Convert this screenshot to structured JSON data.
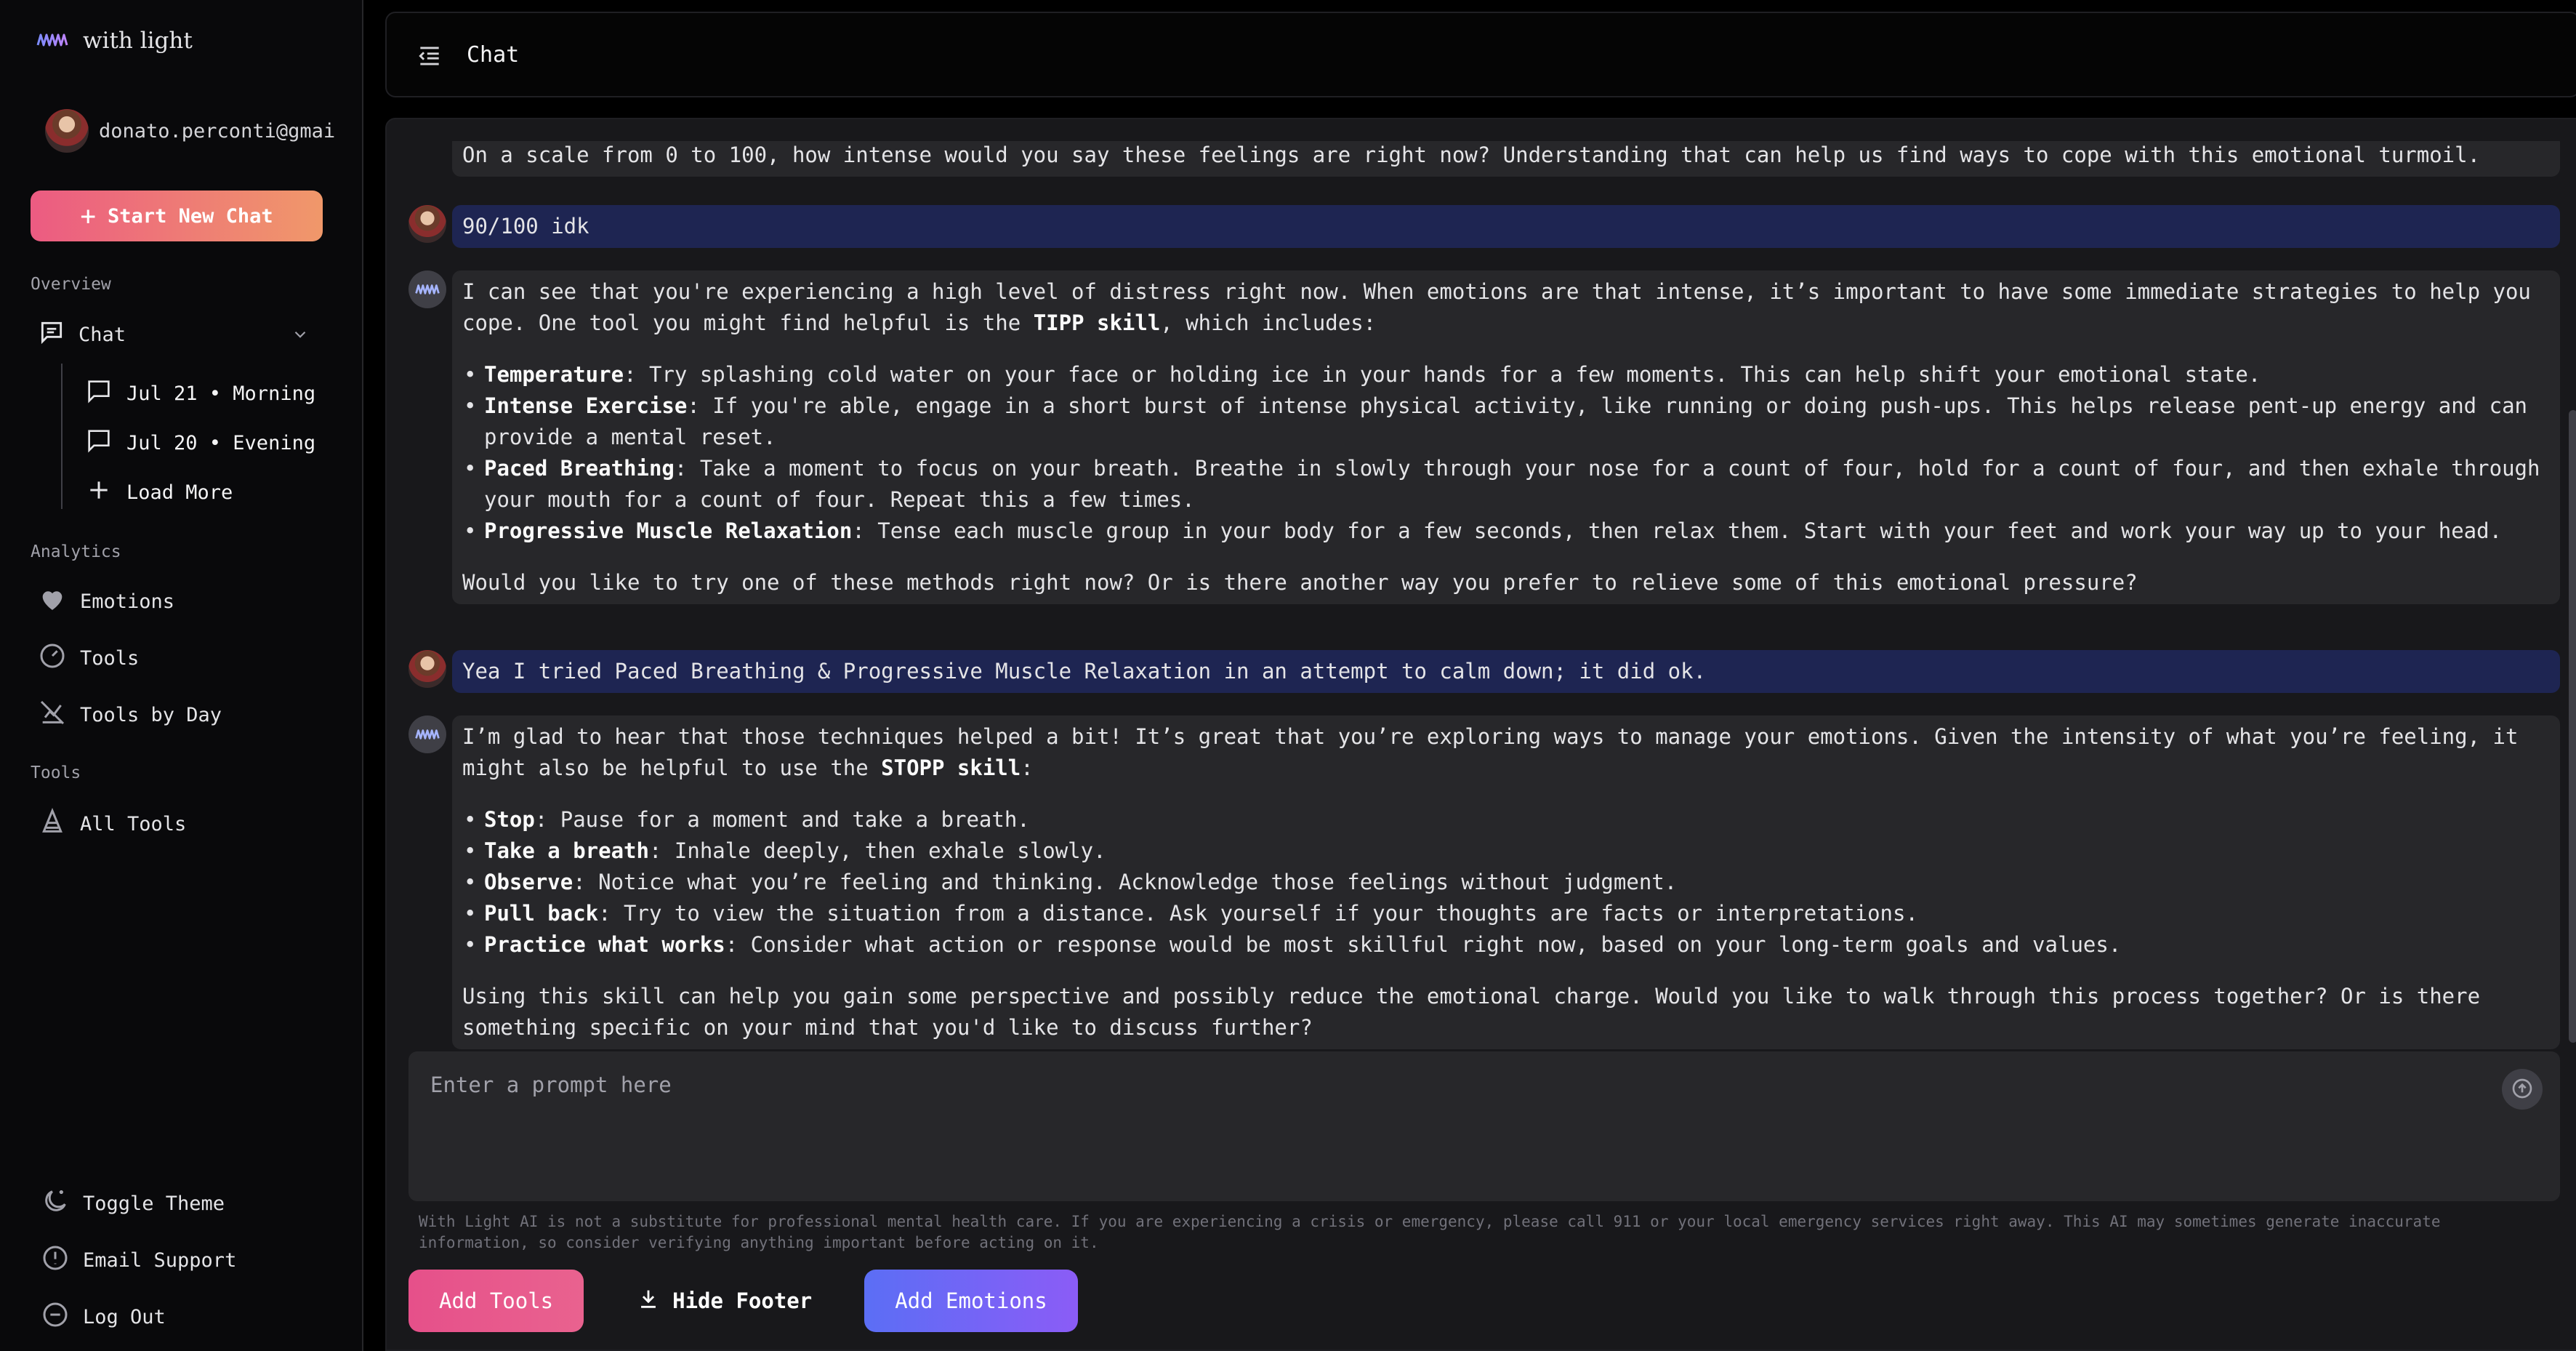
{
  "brand": {
    "name": "with light"
  },
  "user": {
    "email": "donato.perconti@gmai"
  },
  "sidebar": {
    "new_chat_label": "Start New Chat",
    "overview_label": "Overview",
    "chat_label": "Chat",
    "chat_items": [
      {
        "label": "Jul 21 • Morning"
      },
      {
        "label": "Jul 20 • Evening"
      }
    ],
    "load_more_label": "Load More",
    "analytics_label": "Analytics",
    "analytics_items": [
      {
        "label": "Emotions",
        "icon": "heart-icon"
      },
      {
        "label": "Tools",
        "icon": "dial-icon"
      },
      {
        "label": "Tools by Day",
        "icon": "chart-icon"
      }
    ],
    "tools_label": "Tools",
    "all_tools_label": "All Tools",
    "bottom_items": [
      {
        "label": "Toggle Theme",
        "icon": "moon-icon"
      },
      {
        "label": "Email Support",
        "icon": "alert-icon"
      },
      {
        "label": "Log Out",
        "icon": "logout-icon"
      }
    ]
  },
  "header": {
    "title": "Chat"
  },
  "messages": [
    {
      "role": "assistant",
      "text": "On a scale from 0 to 100, how intense would you say these feelings are right now? Understanding that can help us find ways to cope with this emotional turmoil."
    },
    {
      "role": "user",
      "text": "90/100 idk"
    },
    {
      "role": "assistant",
      "intro_a": "I can see that you're experiencing a high level of distress right now. When emotions are that intense, it’s important to have some immediate strategies to help you cope. One tool you might find helpful is the ",
      "intro_bold": "TIPP skill",
      "intro_b": ", which includes:",
      "items": [
        {
          "term": "Temperature",
          "text": ": Try splashing cold water on your face or holding ice in your hands for a few moments. This can help shift your emotional state."
        },
        {
          "term": "Intense Exercise",
          "text": ": If you're able, engage in a short burst of intense physical activity, like running or doing push-ups. This helps release pent-up energy and can provide a mental reset."
        },
        {
          "term": "Paced Breathing",
          "text": ": Take a moment to focus on your breath. Breathe in slowly through your nose for a count of four, hold for a count of four, and then exhale through your mouth for a count of four. Repeat this a few times."
        },
        {
          "term": "Progressive Muscle Relaxation",
          "text": ": Tense each muscle group in your body for a few seconds, then relax them. Start with your feet and work your way up to your head."
        }
      ],
      "outro": "Would you like to try one of these methods right now? Or is there another way you prefer to relieve some of this emotional pressure?"
    },
    {
      "role": "user",
      "text": "Yea I tried Paced Breathing & Progressive Muscle Relaxation in an attempt to calm down; it did ok."
    },
    {
      "role": "assistant",
      "intro_a": "I’m glad to hear that those techniques helped a bit! It’s great that you’re exploring ways to manage your emotions. Given the intensity of what you’re feeling, it might also be helpful to use the ",
      "intro_bold": "STOPP skill",
      "intro_b": ":",
      "items": [
        {
          "term": "Stop",
          "text": ": Pause for a moment and take a breath."
        },
        {
          "term": "Take a breath",
          "text": ": Inhale deeply, then exhale slowly."
        },
        {
          "term": "Observe",
          "text": ": Notice what you’re feeling and thinking. Acknowledge those feelings without judgment."
        },
        {
          "term": "Pull back",
          "text": ": Try to view the situation from a distance. Ask yourself if your thoughts are facts or interpretations."
        },
        {
          "term": "Practice what works",
          "text": ": Consider what action or response would be most skillful right now, based on your long-term goals and values."
        }
      ],
      "outro": "Using this skill can help you gain some perspective and possibly reduce the emotional charge. Would you like to walk through this process together? Or is there something specific on your mind that you'd like to discuss further?"
    }
  ],
  "prompt": {
    "placeholder": "Enter a prompt here"
  },
  "disclaimer": "With Light AI is not a substitute for professional mental health care. If you are experiencing a crisis or emergency, please call 911 or your local emergency services right away. This AI may sometimes generate inaccurate information, so consider verifying anything important before acting on it.",
  "footer_buttons": {
    "add_tools": "Add Tools",
    "hide_footer": "Hide Footer",
    "add_emotions": "Add Emotions"
  },
  "colors": {
    "user_bubble": "#1e2552",
    "ai_bubble": "#27272a",
    "new_chat_gradient": [
      "#ec5b82",
      "#f0986a"
    ],
    "add_tools": "#e6508a",
    "add_emotions": [
      "#5b6ef5",
      "#8b5cf6"
    ]
  }
}
